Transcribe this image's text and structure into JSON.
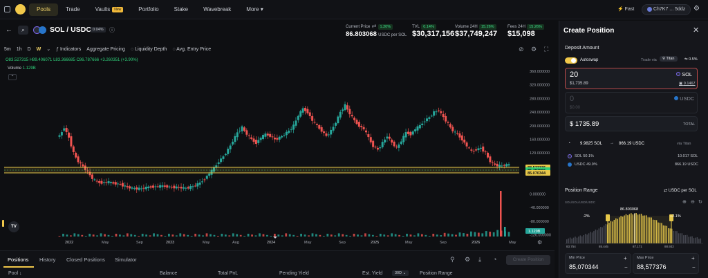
{
  "nav": {
    "items": [
      {
        "label": "Pools",
        "active": true
      },
      {
        "label": "Trade"
      },
      {
        "label": "Vaults",
        "badge": "New"
      },
      {
        "label": "Portfolio"
      },
      {
        "label": "Stake"
      },
      {
        "label": "Wavebreak"
      },
      {
        "label": "More"
      }
    ],
    "priority": "Fast",
    "wallet": "Ch7K7 ... 5ddz"
  },
  "pair": {
    "name": "SOL / USDC",
    "fee": "0.04%"
  },
  "stats": {
    "current_price": {
      "label": "Current Price",
      "change": "1.20%",
      "value": "86.803068",
      "unit": "USDC per SOL"
    },
    "tvl": {
      "label": "TVL",
      "change": "0.14%",
      "value": "$30,317,156"
    },
    "volume": {
      "label": "Volume 24H",
      "change": "15.26%",
      "value": "$37,749,247"
    },
    "fees": {
      "label": "Fees 24H",
      "change": "15.26%",
      "value": "$15,098"
    }
  },
  "toolbar": {
    "intervals": [
      "5m",
      "1h",
      "D",
      "W"
    ],
    "active_interval": "W",
    "indicators": "Indicators",
    "aggregate": "Aggregate Pricing",
    "liquidity": "Liquidity Depth",
    "entry": "Avg. Entry Price"
  },
  "ohlc": {
    "o": "O83.527315",
    "h": "H89.406071",
    "l": "L83.366685",
    "c": "C86.787666",
    "chg": "+3.260351 (+3.90%)",
    "volume_label": "Volume",
    "volume_value": "1.129B"
  },
  "chart_data": {
    "type": "candlestick",
    "x_ticks": [
      "2022",
      "May",
      "Sep",
      "2023",
      "May",
      "Aug",
      "2024",
      "May",
      "Sep",
      "2025",
      "May",
      "Sep",
      "2026",
      "May"
    ],
    "y_ticks": [
      "360.000000",
      "320.000000",
      "280.000000",
      "240.000000",
      "200.000000",
      "160.000000",
      "120.000000",
      "0.000000",
      "-40.000000",
      "-80.000000",
      "-120.000000"
    ],
    "ylim": [
      -125,
      370
    ],
    "price_tags": [
      {
        "value": "88.577376",
        "color": "#e7c84a"
      },
      {
        "value": "86.787666",
        "color": "#2fd07a"
      },
      {
        "value": "85.070344",
        "color": "#e7c84a"
      }
    ],
    "volume_tag": "1.129B",
    "series": [
      {
        "name": "price",
        "values": [
          170,
          195,
          165,
          120,
          95,
          80,
          65,
          45,
          35,
          33,
          35,
          33,
          30,
          28,
          22,
          18,
          16,
          15,
          17,
          20,
          21,
          22,
          23,
          21,
          20,
          19,
          18,
          17,
          20,
          25,
          32,
          45,
          60,
          75,
          95,
          110,
          130,
          155,
          180,
          195,
          175,
          160,
          150,
          165,
          175,
          170,
          160,
          165,
          175,
          185,
          200,
          230,
          250,
          240,
          215,
          200,
          185,
          170,
          185,
          210,
          240,
          260,
          235,
          215,
          200,
          190,
          165,
          140,
          130,
          150,
          170,
          150,
          135,
          155,
          180,
          175,
          190,
          200,
          215,
          225,
          240,
          245,
          225,
          205,
          185,
          175,
          160,
          140,
          125,
          130,
          135,
          120,
          95,
          85,
          82,
          84,
          86
        ]
      }
    ]
  },
  "bottom": {
    "tabs": [
      "Positions",
      "History",
      "Closed Positions",
      "Simulator"
    ],
    "columns": [
      "Pool",
      "Balance",
      "Total PnL",
      "Pending Yield",
      "Est. Yield",
      "30D",
      "Position Range"
    ],
    "create_btn": "Create Position"
  },
  "panel": {
    "title": "Create Position",
    "deposit_title": "Deposit Amount",
    "autoswap": "Autoswap",
    "trade_via": "Trade via",
    "router": "Titan",
    "slippage": "0.5%",
    "sol_amount": "20",
    "sol_symbol": "SOL",
    "sol_usd": "$1,735.89",
    "sol_balance": "0.1467",
    "usdc_amount": "0",
    "usdc_symbol": "USDC",
    "usdc_usd": "$0.00",
    "total_value": "$ 1735.89",
    "total_label": "TOTAL",
    "swap_sol": "9.9825 SOL",
    "swap_usdc": "866.19 USDC",
    "swap_via": "via Titan",
    "sol_pct_label": "SOL 50.1%",
    "sol_pct_value": "10.017 SOL",
    "usdc_pct_label": "USDC 49.9%",
    "usdc_pct_value": "866.19 USDC",
    "range_title": "Position Range",
    "range_unit": "USDC per SOL",
    "range_sub": "SOL/SOL/USD/USDC",
    "current_marker": "86.803068",
    "low_pct": "-2%",
    "high_pct": "+2.1%",
    "axis": [
      "83.754",
      "85.445",
      "87.171",
      "88.932"
    ],
    "min_label": "Min Price",
    "min_value": "85,070344",
    "max_label": "Max Price",
    "max_value": "88,577376"
  }
}
